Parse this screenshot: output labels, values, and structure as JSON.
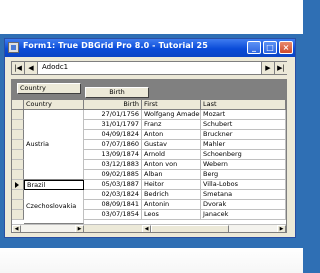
{
  "window": {
    "title": "Form1:  True DBGrid Pro 8.0 - Tutorial 25",
    "minimize_glyph": "_",
    "maximize_glyph": "□",
    "close_glyph": "×"
  },
  "navigator": {
    "label": "Adodc1",
    "first_glyph": "|◀",
    "prev_glyph": "◀",
    "next_glyph": "▶",
    "last_glyph": "▶|"
  },
  "grid": {
    "group_by": [
      "Country",
      "Birth"
    ],
    "columns": [
      "Country",
      "Birth",
      "First",
      "Last"
    ],
    "rows": [
      {
        "birth": "27/01/1756",
        "first": "Wolfgang Amadeus",
        "last": "Mozart"
      },
      {
        "birth": "31/01/1797",
        "first": "Franz",
        "last": "Schubert"
      },
      {
        "birth": "04/09/1824",
        "first": "Anton",
        "last": "Bruckner"
      },
      {
        "birth": "07/07/1860",
        "first": "Gustav",
        "last": "Mahler"
      },
      {
        "birth": "13/09/1874",
        "first": "Arnold",
        "last": "Schoenberg"
      },
      {
        "birth": "03/12/1883",
        "first": "Anton von",
        "last": "Webern"
      },
      {
        "birth": "09/02/1885",
        "first": "Alban",
        "last": "Berg"
      },
      {
        "birth": "05/03/1887",
        "first": "Heitor",
        "last": "Villa-Lobos"
      },
      {
        "birth": "02/03/1824",
        "first": "Bedrich",
        "last": "Smetana"
      },
      {
        "birth": "08/09/1841",
        "first": "Antonin",
        "last": "Dvorak"
      },
      {
        "birth": "03/07/1854",
        "first": "Leos",
        "last": "Janacek"
      }
    ],
    "groups": [
      {
        "country": "Austria"
      },
      {
        "country": "Brazil"
      },
      {
        "country": "Czechoslovakia"
      }
    ]
  },
  "colors": {
    "titlebar": "#0a4bd8",
    "desktop": "#2f6fb4",
    "face": "#ece9d8"
  }
}
